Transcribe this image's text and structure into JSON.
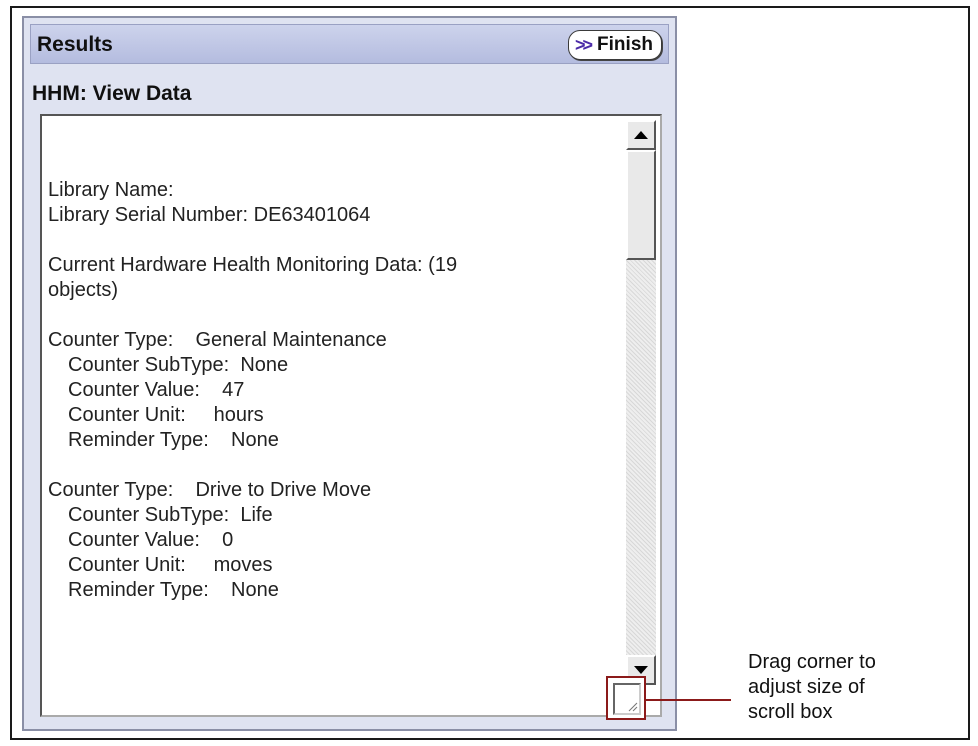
{
  "panel": {
    "title": "Results",
    "finish_button": {
      "icon": "double-chevron-icon",
      "label": "Finish"
    },
    "section_title": "HHM: View Data"
  },
  "scroll_box": {
    "lines": [
      "Library Name:",
      "Library Serial Number: DE63401064",
      "",
      "Current Hardware Health Monitoring Data: (19",
      "objects)",
      "",
      "Counter Type:    General Maintenance",
      "Counter SubType:  None",
      "Counter Value:    47",
      "Counter Unit:     hours",
      "Reminder Type:    None",
      "",
      "Counter Type:    Drive to Drive Move",
      "Counter SubType:  Life",
      "Counter Value:    0",
      "Counter Unit:     moves",
      "Reminder Type:    None"
    ],
    "indented_lines": [
      7,
      8,
      9,
      10,
      13,
      14,
      15,
      16
    ]
  },
  "callout": {
    "line1": "Drag corner to",
    "line2": "adjust size of",
    "line3": "scroll box"
  },
  "colors": {
    "panel_bg": "#dfe3f1",
    "title_bar": "#b4bcdf",
    "chevron": "#4b2aa8",
    "callout": "#8b1a1a"
  }
}
